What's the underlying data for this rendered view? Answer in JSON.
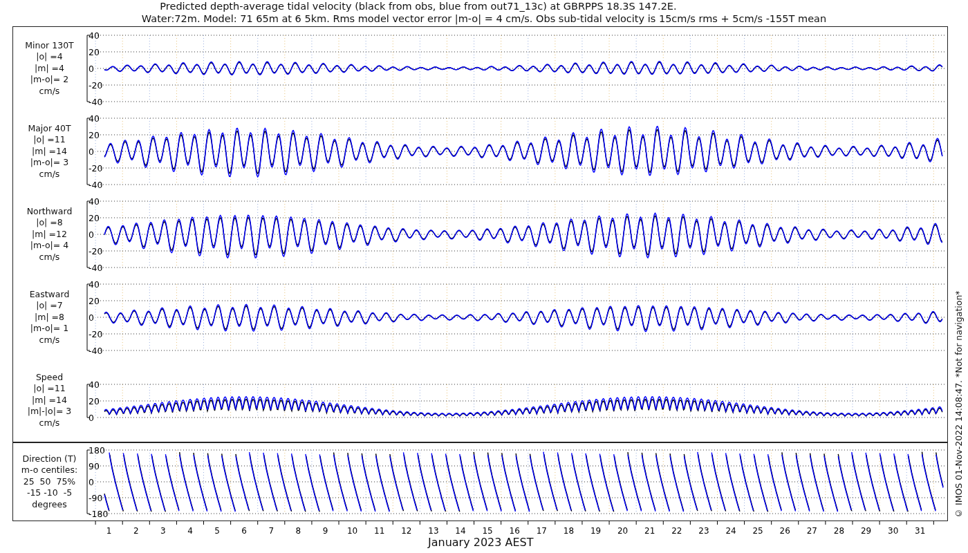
{
  "title": [
    "Predicted depth-average tidal velocity (black from obs, blue from out71_13c) at GBRPPS 18.3S 147.2E.",
    "Water:72m. Model: 71 65m at 6 5km. Rms model vector error |m-o| = 4 cm/s. Obs sub-tidal velocity is 15cm/s rms + 5cm/s -155T mean"
  ],
  "panels": [
    {
      "kind": "signed",
      "label": [
        "Minor 130T",
        "|o| =4",
        "|m| =4",
        "|m-o|= 2",
        "cm/s"
      ],
      "yticks": [
        "40",
        "20",
        "0",
        "-20",
        "-40"
      ]
    },
    {
      "kind": "signed",
      "label": [
        "Major 40T",
        "|o| =11",
        "|m| =14",
        "|m-o|= 3",
        "cm/s"
      ],
      "yticks": [
        "40",
        "20",
        "0",
        "-20",
        "-40"
      ]
    },
    {
      "kind": "signed",
      "label": [
        "Northward",
        "|o| =8",
        "|m| =12",
        "|m-o|= 4",
        "cm/s"
      ],
      "yticks": [
        "40",
        "20",
        "0",
        "-20",
        "-40"
      ]
    },
    {
      "kind": "signed",
      "label": [
        "Eastward",
        "|o| =7",
        "|m| =8",
        "|m-o|= 1",
        "cm/s"
      ],
      "yticks": [
        "40",
        "20",
        "0",
        "-20",
        "-40"
      ]
    },
    {
      "kind": "speed",
      "label": [
        "Speed",
        "|o| =11",
        "|m| =14",
        "|m|-|o|= 3",
        "cm/s"
      ],
      "yticks": [
        "40",
        "20",
        "0"
      ]
    },
    {
      "kind": "direction",
      "label": [
        "Direction (T)",
        "m-o centiles:",
        "25  50  75%",
        "-15 -10  -5",
        "degrees"
      ],
      "yticks": [
        "180",
        "90",
        "0",
        "-90",
        "-180"
      ]
    }
  ],
  "xaxis": {
    "ticks": [
      "1",
      "2",
      "3",
      "4",
      "5",
      "6",
      "7",
      "8",
      "9",
      "10",
      "11",
      "12",
      "13",
      "14",
      "15",
      "16",
      "17",
      "18",
      "19",
      "20",
      "21",
      "22",
      "23",
      "24",
      "25",
      "26",
      "27",
      "28",
      "29",
      "30",
      "31"
    ],
    "label": "January 2023 AEST"
  },
  "credit": "© IMOS 01-Nov-2022 14:08:47. *Not for navigation*"
}
